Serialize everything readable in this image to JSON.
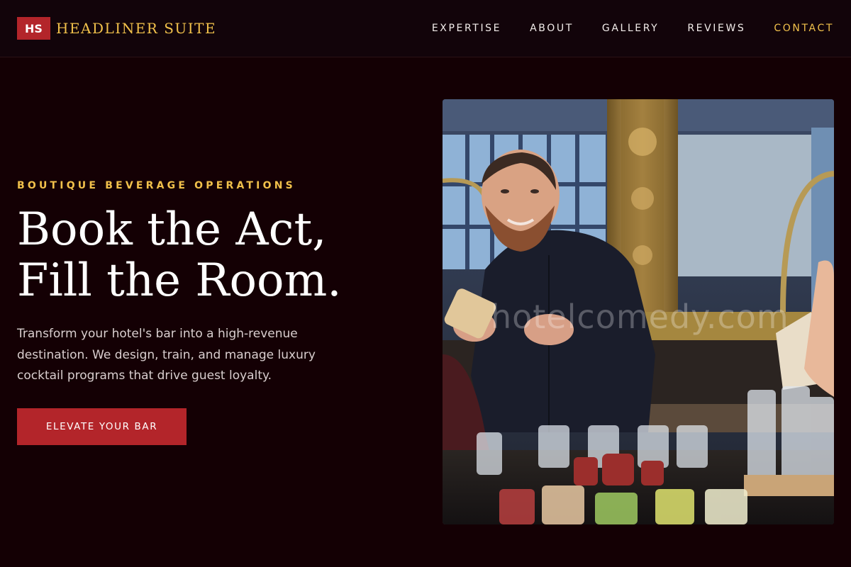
{
  "brand": {
    "badge": "HS",
    "name": "HEADLINER SUITE",
    "accent_color": "#f1c14b",
    "badge_color": "#b3252a"
  },
  "nav": {
    "items": [
      {
        "label": "EXPERTISE"
      },
      {
        "label": "ABOUT"
      },
      {
        "label": "GALLERY"
      },
      {
        "label": "REVIEWS"
      },
      {
        "label": "CONTACT"
      }
    ]
  },
  "hero": {
    "eyebrow": "BOUTIQUE BEVERAGE OPERATIONS",
    "headline_line1": "Book the Act,",
    "headline_line2": "Fill the Room.",
    "description": "Transform your hotel's bar into a high-revenue destination. We design, train, and manage luxury cocktail programs that drive guest loyalty.",
    "cta_label": "ELEVATE YOUR BAR",
    "image": {
      "icon": "bartender-photo",
      "watermark": "hotelcomedy.com"
    }
  },
  "colors": {
    "background": "#140004",
    "header_background": "#12040a",
    "cta": "#b3252a",
    "text_muted": "#d9cfcf"
  }
}
